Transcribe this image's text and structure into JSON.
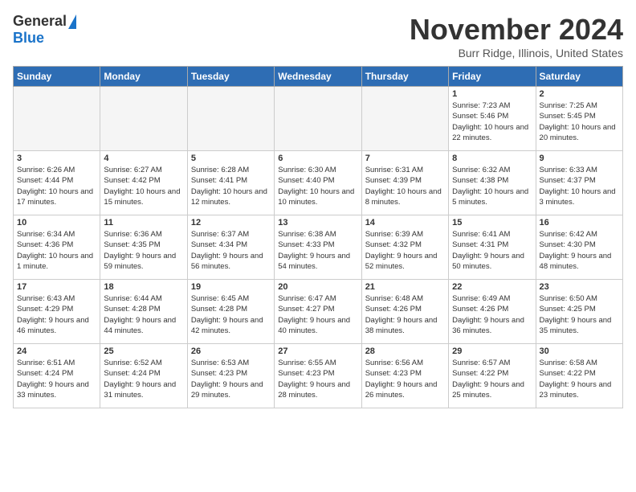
{
  "header": {
    "logo_general": "General",
    "logo_blue": "Blue",
    "month_title": "November 2024",
    "location": "Burr Ridge, Illinois, United States"
  },
  "weekdays": [
    "Sunday",
    "Monday",
    "Tuesday",
    "Wednesday",
    "Thursday",
    "Friday",
    "Saturday"
  ],
  "weeks": [
    [
      {
        "day": "",
        "info": ""
      },
      {
        "day": "",
        "info": ""
      },
      {
        "day": "",
        "info": ""
      },
      {
        "day": "",
        "info": ""
      },
      {
        "day": "",
        "info": ""
      },
      {
        "day": "1",
        "info": "Sunrise: 7:23 AM\nSunset: 5:46 PM\nDaylight: 10 hours and 22 minutes."
      },
      {
        "day": "2",
        "info": "Sunrise: 7:25 AM\nSunset: 5:45 PM\nDaylight: 10 hours and 20 minutes."
      }
    ],
    [
      {
        "day": "3",
        "info": "Sunrise: 6:26 AM\nSunset: 4:44 PM\nDaylight: 10 hours and 17 minutes."
      },
      {
        "day": "4",
        "info": "Sunrise: 6:27 AM\nSunset: 4:42 PM\nDaylight: 10 hours and 15 minutes."
      },
      {
        "day": "5",
        "info": "Sunrise: 6:28 AM\nSunset: 4:41 PM\nDaylight: 10 hours and 12 minutes."
      },
      {
        "day": "6",
        "info": "Sunrise: 6:30 AM\nSunset: 4:40 PM\nDaylight: 10 hours and 10 minutes."
      },
      {
        "day": "7",
        "info": "Sunrise: 6:31 AM\nSunset: 4:39 PM\nDaylight: 10 hours and 8 minutes."
      },
      {
        "day": "8",
        "info": "Sunrise: 6:32 AM\nSunset: 4:38 PM\nDaylight: 10 hours and 5 minutes."
      },
      {
        "day": "9",
        "info": "Sunrise: 6:33 AM\nSunset: 4:37 PM\nDaylight: 10 hours and 3 minutes."
      }
    ],
    [
      {
        "day": "10",
        "info": "Sunrise: 6:34 AM\nSunset: 4:36 PM\nDaylight: 10 hours and 1 minute."
      },
      {
        "day": "11",
        "info": "Sunrise: 6:36 AM\nSunset: 4:35 PM\nDaylight: 9 hours and 59 minutes."
      },
      {
        "day": "12",
        "info": "Sunrise: 6:37 AM\nSunset: 4:34 PM\nDaylight: 9 hours and 56 minutes."
      },
      {
        "day": "13",
        "info": "Sunrise: 6:38 AM\nSunset: 4:33 PM\nDaylight: 9 hours and 54 minutes."
      },
      {
        "day": "14",
        "info": "Sunrise: 6:39 AM\nSunset: 4:32 PM\nDaylight: 9 hours and 52 minutes."
      },
      {
        "day": "15",
        "info": "Sunrise: 6:41 AM\nSunset: 4:31 PM\nDaylight: 9 hours and 50 minutes."
      },
      {
        "day": "16",
        "info": "Sunrise: 6:42 AM\nSunset: 4:30 PM\nDaylight: 9 hours and 48 minutes."
      }
    ],
    [
      {
        "day": "17",
        "info": "Sunrise: 6:43 AM\nSunset: 4:29 PM\nDaylight: 9 hours and 46 minutes."
      },
      {
        "day": "18",
        "info": "Sunrise: 6:44 AM\nSunset: 4:28 PM\nDaylight: 9 hours and 44 minutes."
      },
      {
        "day": "19",
        "info": "Sunrise: 6:45 AM\nSunset: 4:28 PM\nDaylight: 9 hours and 42 minutes."
      },
      {
        "day": "20",
        "info": "Sunrise: 6:47 AM\nSunset: 4:27 PM\nDaylight: 9 hours and 40 minutes."
      },
      {
        "day": "21",
        "info": "Sunrise: 6:48 AM\nSunset: 4:26 PM\nDaylight: 9 hours and 38 minutes."
      },
      {
        "day": "22",
        "info": "Sunrise: 6:49 AM\nSunset: 4:26 PM\nDaylight: 9 hours and 36 minutes."
      },
      {
        "day": "23",
        "info": "Sunrise: 6:50 AM\nSunset: 4:25 PM\nDaylight: 9 hours and 35 minutes."
      }
    ],
    [
      {
        "day": "24",
        "info": "Sunrise: 6:51 AM\nSunset: 4:24 PM\nDaylight: 9 hours and 33 minutes."
      },
      {
        "day": "25",
        "info": "Sunrise: 6:52 AM\nSunset: 4:24 PM\nDaylight: 9 hours and 31 minutes."
      },
      {
        "day": "26",
        "info": "Sunrise: 6:53 AM\nSunset: 4:23 PM\nDaylight: 9 hours and 29 minutes."
      },
      {
        "day": "27",
        "info": "Sunrise: 6:55 AM\nSunset: 4:23 PM\nDaylight: 9 hours and 28 minutes."
      },
      {
        "day": "28",
        "info": "Sunrise: 6:56 AM\nSunset: 4:23 PM\nDaylight: 9 hours and 26 minutes."
      },
      {
        "day": "29",
        "info": "Sunrise: 6:57 AM\nSunset: 4:22 PM\nDaylight: 9 hours and 25 minutes."
      },
      {
        "day": "30",
        "info": "Sunrise: 6:58 AM\nSunset: 4:22 PM\nDaylight: 9 hours and 23 minutes."
      }
    ]
  ]
}
